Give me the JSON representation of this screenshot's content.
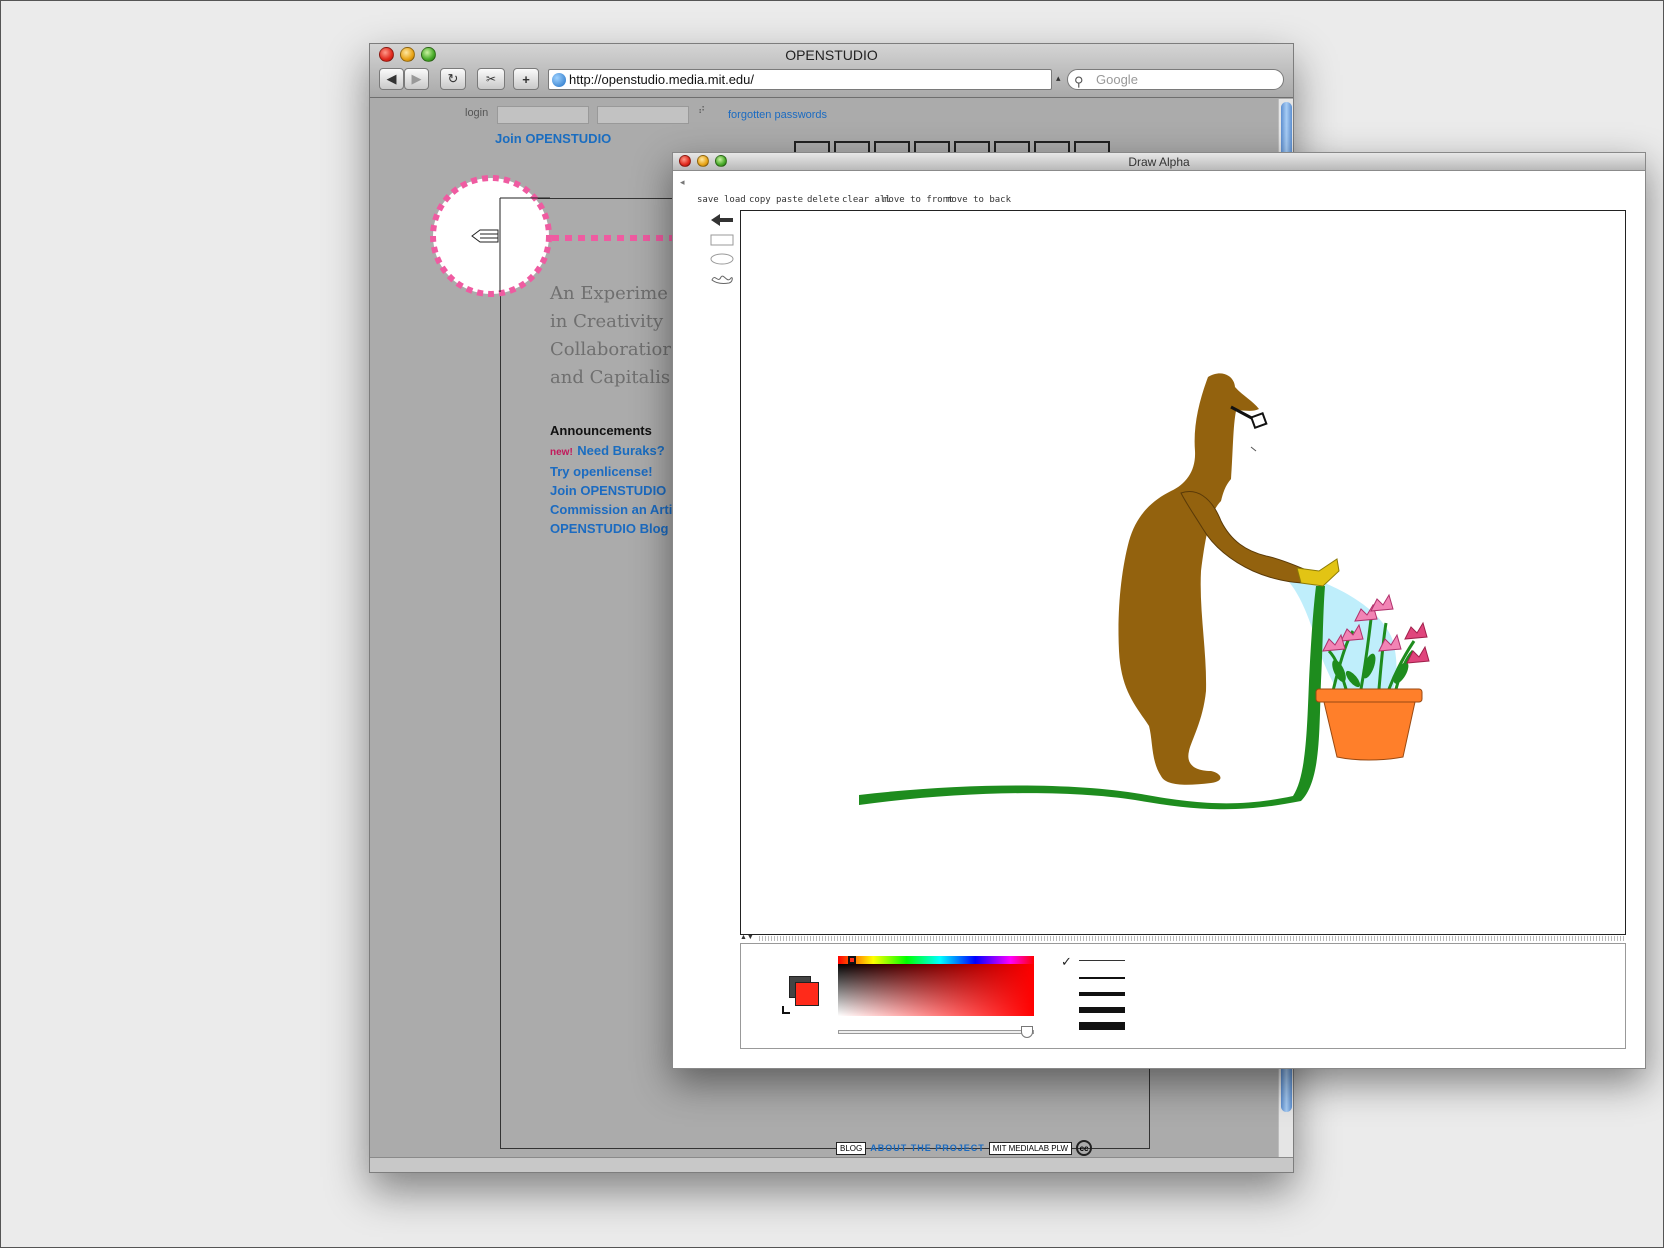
{
  "safari": {
    "title": "OPENSTUDIO",
    "url": "http://openstudio.media.mit.edu/",
    "search_placeholder": "Google",
    "login_label": "login",
    "forgotten_label": "forgotten passwords",
    "join_link": "Join OPENSTUDIO",
    "tagline": [
      "An Experime",
      "in Creativity",
      "Collaboratior",
      "and Capitalis"
    ],
    "announcements_title": "Announcements",
    "new_badge": "new!",
    "announcements": [
      "Need Buraks?",
      "Try openlicense!",
      "Join OPENSTUDIO",
      "Commission an Arti",
      "OPENSTUDIO Blog"
    ],
    "footer": {
      "blog": "BLOG",
      "about": "ABOUT THE PROJECT",
      "medialab": "MIT MEDIALAB PLW",
      "cc": "cc"
    }
  },
  "draw_window": {
    "title": "Draw Alpha",
    "back_arrow": "◂",
    "menu": [
      "save",
      "load",
      "copy",
      "paste",
      "delete",
      "clear all",
      "move to front",
      "move to back"
    ],
    "tools": [
      "select-arrow",
      "rectangle",
      "ellipse",
      "freeform"
    ],
    "current_color": "#ff2a1a",
    "secondary_color": "#444444",
    "brush_sizes_selected": 0
  },
  "colors": {
    "accent_pink": "#ef5ba1",
    "link_blue": "#1b6bc1",
    "bear_brown": "#93620e",
    "hose_green": "#1e8c1e",
    "pot_orange": "#ff7f2a",
    "water_blue": "#bfeefb"
  }
}
